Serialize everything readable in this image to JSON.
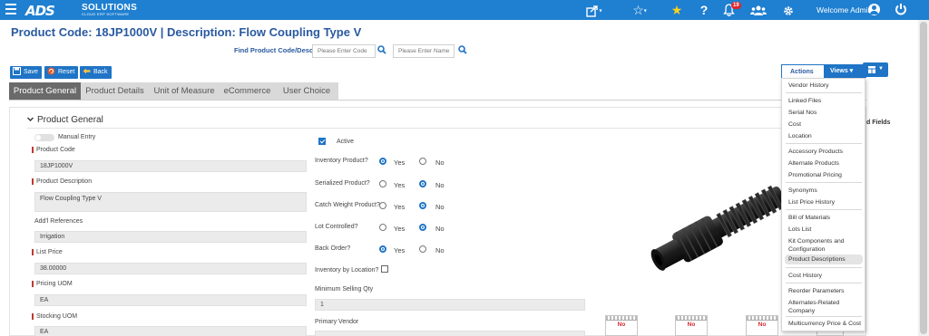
{
  "topbar": {
    "logo_mark": "ADS",
    "logo_text": "SOLUTIONS",
    "logo_sub": "CLOUD ERP SOFTWARE",
    "welcome": "Welcome Admin",
    "notification_count": "19",
    "help": "?"
  },
  "page": {
    "title": "Product Code:  18JP1000V | Description: Flow Coupling Type V",
    "find_label": "Find Product Code/Desc",
    "code_placeholder": "Please Enter Code",
    "name_placeholder": "Please Enter Name"
  },
  "toolbar": {
    "save": "Save",
    "reset": "Reset",
    "back": "Back"
  },
  "tabs": [
    "Product General",
    "Product Details",
    "Unit of Measure",
    "eCommerce",
    "User Choice"
  ],
  "section": {
    "title": "Product General"
  },
  "left_fields": {
    "manual_entry": "Manual Entry",
    "product_code_label": "Product Code",
    "product_code": "18JP1000V",
    "description_label": "Product Description",
    "description": "Flow Coupling Type V",
    "addl_ref_label": "Add'l References",
    "addl_ref": "Irrigation",
    "list_price_label": "List Price",
    "list_price": "38.00000",
    "pricing_uom_label": "Pricing UOM",
    "pricing_uom": "EA",
    "stocking_uom_label": "Stocking UOM",
    "stocking_uom": "EA"
  },
  "mid_fields": {
    "active": "Active",
    "inventory": "Inventory Product?",
    "serialized": "Serialized Product?",
    "catch_weight": "Catch Weight Product?",
    "lot_controlled": "Lot Controlled?",
    "back_order": "Back Order?",
    "inv_by_location": "Inventory by Location?",
    "min_qty_label": "Minimum Selling Qty",
    "min_qty": "1",
    "primary_vendor_label": "Primary Vendor",
    "yes": "Yes",
    "no": "No"
  },
  "no_image_text": "No",
  "actions": {
    "actions_label": "Actions",
    "views_label": "Views",
    "fields_label": "d Fields",
    "items": [
      "Vendor History",
      "Linked Files",
      "Serial Nos",
      "Cost",
      "Location",
      "Accessory Products",
      "Alternate Products",
      "Promotional Pricing",
      "Synonyms",
      "List Price History",
      "Bill of Materials",
      "Lots List",
      "Kit Components and",
      "Configuration",
      "Product Descriptions",
      "Cost History",
      "Reorder Parameters",
      "Alternates-Related",
      "Company",
      "Multicurrency Price & Cost"
    ]
  },
  "colors": {
    "topbar": "#1f7fd0",
    "button": "#1f74c6",
    "title": "#2a5aa0",
    "required": "#c0392b",
    "badge": "#e0262b",
    "star": "#ffd31a"
  }
}
